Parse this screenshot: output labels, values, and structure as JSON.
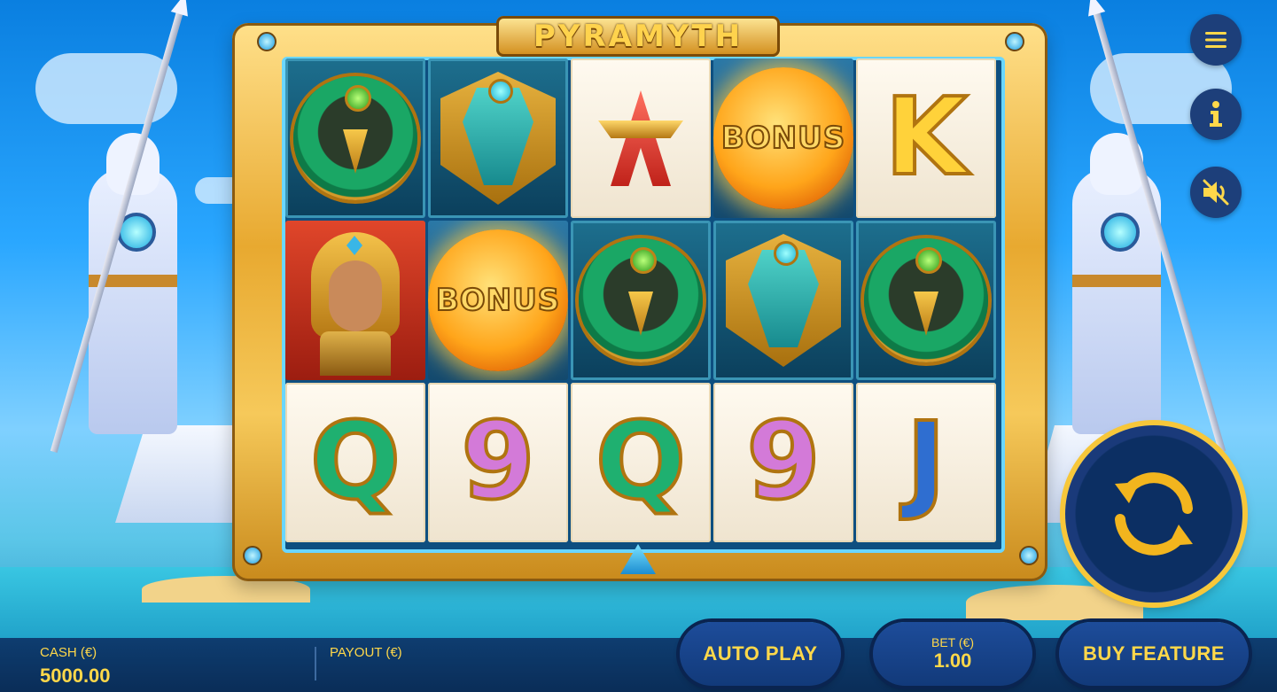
{
  "game": {
    "logo_text": "PYRAMYTH"
  },
  "reels": [
    [
      {
        "symbol": "horus-medallion"
      },
      {
        "symbol": "queen"
      },
      {
        "symbol": "Q"
      }
    ],
    [
      {
        "symbol": "sobek-shield"
      },
      {
        "symbol": "bonus",
        "label": "BONUS"
      },
      {
        "symbol": "9"
      }
    ],
    [
      {
        "symbol": "A"
      },
      {
        "symbol": "horus-medallion"
      },
      {
        "symbol": "Q"
      }
    ],
    [
      {
        "symbol": "bonus",
        "label": "BONUS"
      },
      {
        "symbol": "sobek-shield"
      },
      {
        "symbol": "9"
      }
    ],
    [
      {
        "symbol": "K"
      },
      {
        "symbol": "horus-medallion"
      },
      {
        "symbol": "J"
      }
    ]
  ],
  "symbols_text": {
    "q": "Q",
    "nine": "9",
    "j": "J",
    "a": "A",
    "k": "K",
    "bonus": "BONUS"
  },
  "controls": {
    "menu_icon": "hamburger-menu-icon",
    "info_icon": "info-icon",
    "sound_icon": "sound-muted-icon",
    "spin_icon": "spin-arrows-icon"
  },
  "footer": {
    "cash_label": "CASH (€)",
    "cash_value": "5000.00",
    "payout_label": "PAYOUT (€)",
    "auto_play_label": "AUTO PLAY",
    "bet_label": "BET (€)",
    "bet_value": "1.00",
    "buy_feature_label": "BUY FEATURE"
  },
  "colors": {
    "accent_gold": "#ffd84a",
    "button_blue": "#1d4c9a",
    "bar_blue": "#0e3d70"
  }
}
